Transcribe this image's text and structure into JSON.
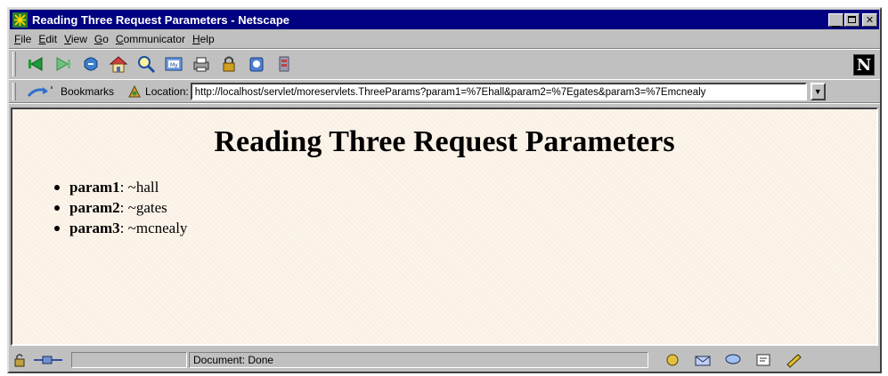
{
  "window": {
    "title": "Reading Three Request Parameters - Netscape",
    "buttons": {
      "minimize": "_",
      "maximize": "□",
      "close": "×"
    }
  },
  "menubar": {
    "items": [
      {
        "label_first": "F",
        "label_rest": "ile"
      },
      {
        "label_first": "E",
        "label_rest": "dit"
      },
      {
        "label_first": "V",
        "label_rest": "iew"
      },
      {
        "label_first": "G",
        "label_rest": "o"
      },
      {
        "label_first": "C",
        "label_rest": "ommunicator"
      },
      {
        "label_first": "H",
        "label_rest": "elp"
      }
    ]
  },
  "toolbar": {
    "buttons": [
      "back-icon",
      "forward-icon",
      "reload-icon",
      "home-icon",
      "search-icon",
      "guide-icon",
      "print-icon",
      "security-icon",
      "shop-icon",
      "stop-icon"
    ],
    "logo": "N"
  },
  "locationbar": {
    "bookmarks_label": "Bookmarks",
    "location_label": "Location:",
    "url": "http://localhost/servlet/moreservlets.ThreeParams?param1=%7Ehall&param2=%7Egates&param3=%7Emcnealy"
  },
  "page": {
    "heading": "Reading Three Request Parameters",
    "params": [
      {
        "name": "param1",
        "value": ": ~hall"
      },
      {
        "name": "param2",
        "value": ": ~gates"
      },
      {
        "name": "param3",
        "value": ": ~mcnealy"
      }
    ]
  },
  "statusbar": {
    "text": "Document: Done"
  },
  "colors": {
    "titlebar": "#000080",
    "chrome": "#c0c0c0",
    "content_bg": "#fdf5ea"
  }
}
